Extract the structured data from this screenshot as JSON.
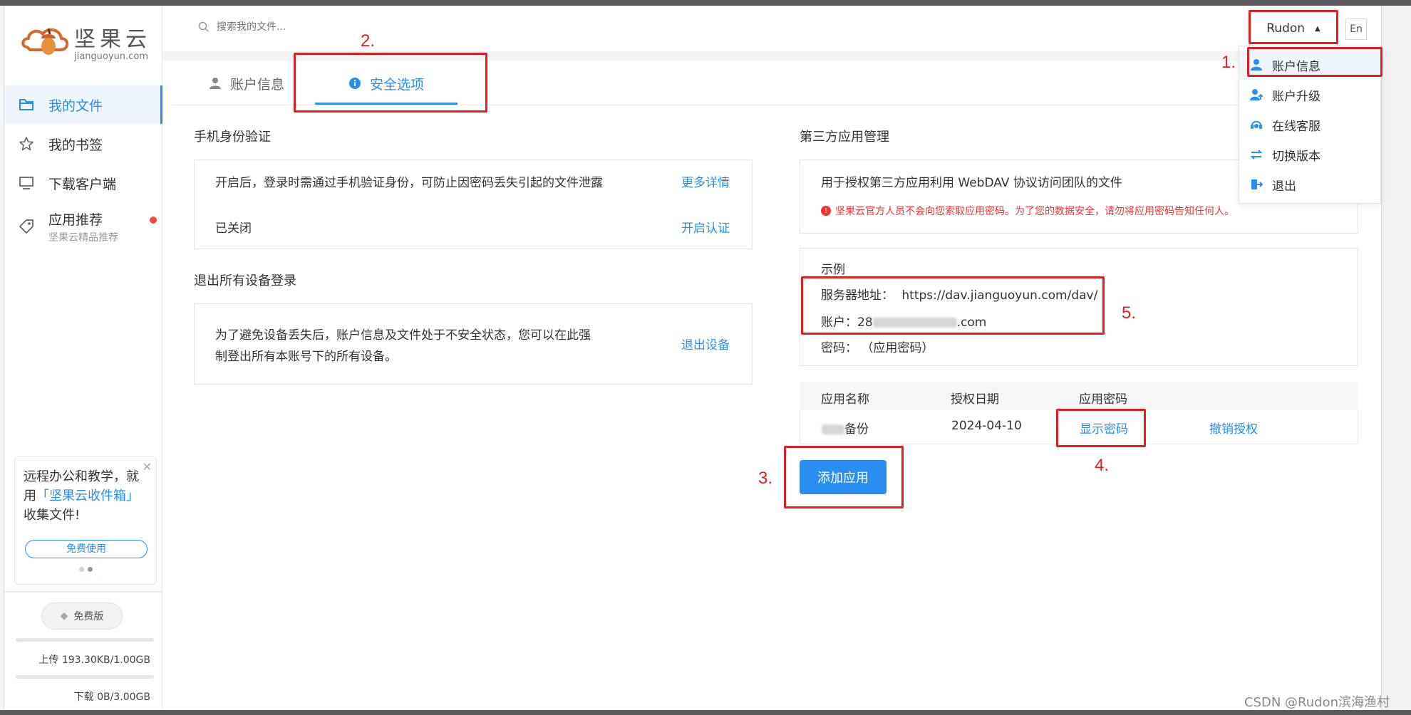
{
  "logo": {
    "cn": "坚果云",
    "en": "jianguoyun.com"
  },
  "sidebar": {
    "items": [
      {
        "label": "我的文件",
        "icon": "folder-icon"
      },
      {
        "label": "我的书签",
        "icon": "star-icon"
      },
      {
        "label": "下载客户端",
        "icon": "monitor-icon"
      },
      {
        "label": "应用推荐",
        "sub": "坚果云精品推荐",
        "icon": "tag-icon"
      }
    ],
    "promo": {
      "text_before": "远程办公和教学，就用",
      "highlight": "「坚果云收件箱」",
      "text_after": "收集文件!",
      "button": "免费使用"
    },
    "plan": "免费版",
    "upload": "上传 193.30KB/1.00GB",
    "download": "下载 0B/3.00GB"
  },
  "topbar": {
    "search_placeholder": "搜索我的文件...",
    "user": "Rudon",
    "lang": "En"
  },
  "dropdown": {
    "items": [
      "账户信息",
      "账户升级",
      "在线客服",
      "切换版本",
      "退出"
    ]
  },
  "tabs": [
    {
      "label": "账户信息",
      "icon": "user-icon"
    },
    {
      "label": "安全选项",
      "icon": "info-icon"
    }
  ],
  "phone_verify": {
    "title": "手机身份验证",
    "desc": "开启后，登录时需通过手机验证身份，可防止因密码丢失引起的文件泄露",
    "more": "更多详情",
    "status": "已关闭",
    "enable": "开启认证"
  },
  "logout_all": {
    "title": "退出所有设备登录",
    "desc_line1": "为了避免设备丢失后，账户信息及文件处于不安全状态，您可以在此强",
    "desc_line2": "制登出所有本账号下的所有设备。",
    "action": "退出设备"
  },
  "third_party": {
    "title": "第三方应用管理",
    "desc": "用于授权第三方应用利用 WebDAV 协议访问团队的文件",
    "warning": "坚果云官方人员不会向您索取应用密码。为了您的数据安全，请勿将应用密码告知任何人。",
    "example_title": "示例",
    "server_label": "服务器地址：",
    "server_value": "https://dav.jianguoyun.com/dav/",
    "account_label": "账户：",
    "account_prefix": "28",
    "account_suffix": ".com",
    "password_label": "密码：",
    "password_value": "（应用密码）",
    "table": {
      "headers": [
        "应用名称",
        "授权日期",
        "应用密码"
      ],
      "rows": [
        {
          "name": "备份",
          "date": "2024-04-10",
          "show": "显示密码",
          "revoke": "撤销授权"
        }
      ]
    },
    "add_button": "添加应用"
  },
  "annotations": [
    "1.",
    "2.",
    "3.",
    "4.",
    "5."
  ],
  "watermark": "CSDN @Rudon滨海渔村",
  "colors": {
    "accent": "#2a8ef0",
    "annotation": "#e02020",
    "warning": "#e33333"
  }
}
